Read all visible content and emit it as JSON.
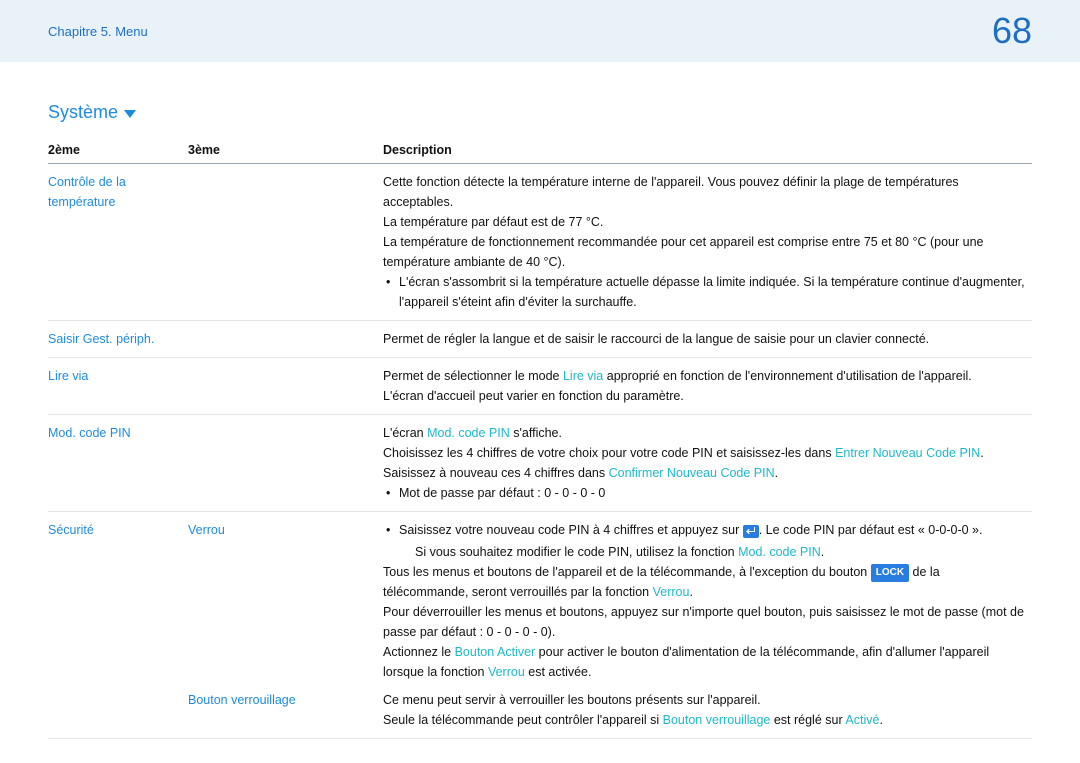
{
  "header": {
    "chapter": "Chapitre 5. Menu",
    "page": "68"
  },
  "section_title": "Système",
  "cols": {
    "c1": "2ème",
    "c2": "3ème",
    "c3": "Description"
  },
  "rows": {
    "temp": {
      "name": "Contrôle de la température",
      "d1": "Cette fonction détecte la température interne de l'appareil. Vous pouvez définir la plage de températures acceptables.",
      "d2": "La température par défaut est de 77 °C.",
      "d3": "La température de fonctionnement recommandée pour cet appareil est comprise entre 75 et 80 °C (pour une température ambiante de 40 °C).",
      "d4": "L'écran s'assombrit si la température actuelle dépasse la limite indiquée. Si la température continue d'augmenter, l'appareil s'éteint afin d'éviter la surchauffe."
    },
    "saisir": {
      "name": "Saisir Gest. périph.",
      "d": "Permet de régler la langue et de saisir le raccourci de la langue de saisie pour un clavier connecté."
    },
    "lire": {
      "name": "Lire via",
      "d1a": "Permet de sélectionner le mode ",
      "d1b": "Lire via",
      "d1c": " approprié en fonction de l'environnement d'utilisation de l'appareil.",
      "d2": "L'écran d'accueil peut varier en fonction du paramètre."
    },
    "pin": {
      "name": "Mod. code PIN",
      "d1a": "L'écran ",
      "d1b": "Mod. code PIN",
      "d1c": " s'affiche.",
      "d2a": "Choisissez les 4 chiffres de votre choix pour votre code PIN et saisissez-les dans ",
      "d2b": "Entrer Nouveau Code PIN",
      "d2c": ". Saisissez à nouveau ces 4 chiffres dans ",
      "d2d": "Confirmer Nouveau Code PIN",
      "d2e": ".",
      "d3": "Mot de passe par défaut : 0 - 0 - 0 - 0"
    },
    "secu": {
      "name": "Sécurité",
      "verrou": {
        "name": "Verrou",
        "b1a": "Saisissez votre nouveau code PIN à 4 chiffres et appuyez sur ",
        "b1b": ". Le code PIN par défaut est « 0-0-0-0 ».",
        "b1_sub_a": "Si vous souhaitez modifier le code PIN, utilisez la fonction ",
        "b1_sub_b": "Mod. code PIN",
        "b1_sub_c": ".",
        "p2a": "Tous les menus et boutons de l'appareil et de la télécommande, à l'exception du bouton ",
        "p2_lock": "LOCK",
        "p2b": " de la télécommande, seront verrouillés par la fonction ",
        "p2c": "Verrou",
        "p2d": ".",
        "p3": "Pour déverrouiller les menus et boutons, appuyez sur n'importe quel bouton, puis saisissez le mot de passe (mot de passe par défaut : 0 - 0 - 0 - 0).",
        "p4a": "Actionnez le ",
        "p4b": "Bouton Activer",
        "p4c": " pour activer le bouton d'alimentation de la télécommande, afin d'allumer l'appareil lorsque la fonction ",
        "p4d": "Verrou",
        "p4e": " est activée."
      },
      "btnlock": {
        "name": "Bouton verrouillage",
        "d1": "Ce menu peut servir à verrouiller les boutons présents sur l'appareil.",
        "d2a": "Seule la télécommande peut contrôler l'appareil si ",
        "d2b": "Bouton verrouillage",
        "d2c": " est réglé sur ",
        "d2d": "Activé",
        "d2e": "."
      }
    }
  }
}
